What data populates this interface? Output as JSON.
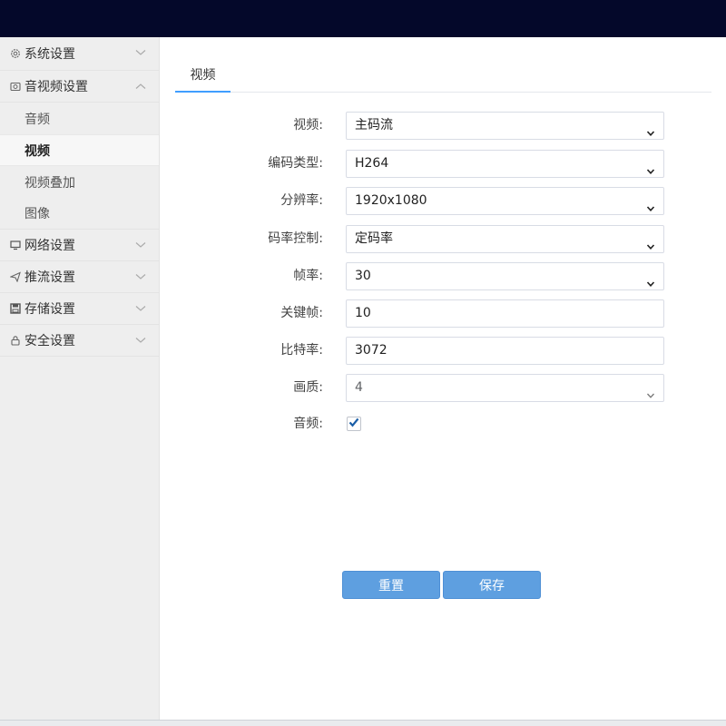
{
  "sidebar": {
    "groups": [
      {
        "icon": "gear-icon",
        "label": "系统设置",
        "expanded": false
      },
      {
        "icon": "camera-icon",
        "label": "音视频设置",
        "expanded": true,
        "items": [
          {
            "label": "音频",
            "active": false
          },
          {
            "label": "视频",
            "active": true
          },
          {
            "label": "视频叠加",
            "active": false
          },
          {
            "label": "图像",
            "active": false
          }
        ]
      },
      {
        "icon": "monitor-icon",
        "label": "网络设置",
        "expanded": false
      },
      {
        "icon": "send-icon",
        "label": "推流设置",
        "expanded": false
      },
      {
        "icon": "save-icon",
        "label": "存储设置",
        "expanded": false
      },
      {
        "icon": "lock-icon",
        "label": "安全设置",
        "expanded": false
      }
    ]
  },
  "tabs": [
    {
      "label": "视频",
      "active": true
    }
  ],
  "form": {
    "video": {
      "label": "视频:",
      "value": "主码流"
    },
    "encode_type": {
      "label": "编码类型:",
      "value": "H264"
    },
    "resolution": {
      "label": "分辨率:",
      "value": "1920x1080"
    },
    "rate_control": {
      "label": "码率控制:",
      "value": "定码率"
    },
    "frame_rate": {
      "label": "帧率:",
      "value": "30"
    },
    "keyframe": {
      "label": "关键帧:",
      "value": "10"
    },
    "bitrate": {
      "label": "比特率:",
      "value": "3072"
    },
    "quality": {
      "label": "画质:",
      "value": "4"
    },
    "audio": {
      "label": "音频:",
      "checked": true
    }
  },
  "buttons": {
    "reset": "重置",
    "save": "保存"
  },
  "colors": {
    "topbar": "#04082a",
    "accent": "#409eff",
    "button": "#5e9fe0"
  }
}
